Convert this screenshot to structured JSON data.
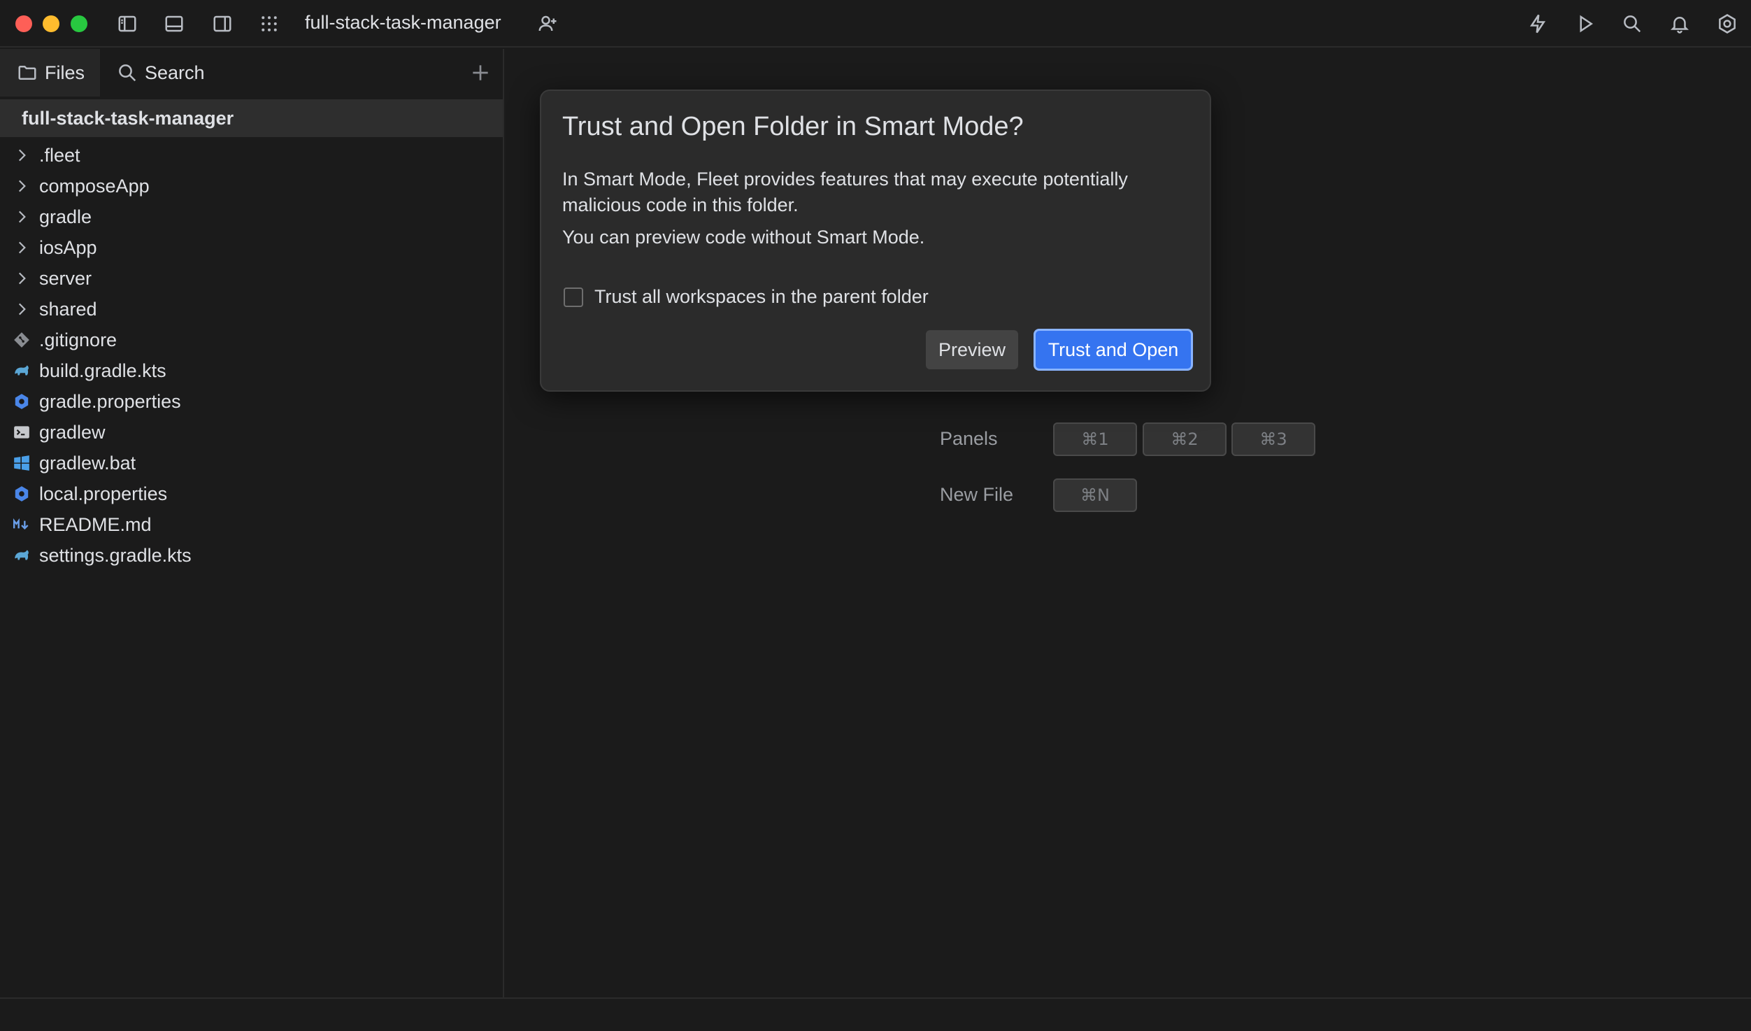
{
  "window": {
    "project_title": "full-stack-task-manager"
  },
  "sidebar": {
    "tabs": [
      {
        "label": "Files",
        "icon": "folder-icon"
      },
      {
        "label": "Search",
        "icon": "search-icon"
      }
    ],
    "root": "full-stack-task-manager",
    "items": [
      {
        "label": ".fleet",
        "type": "folder"
      },
      {
        "label": "composeApp",
        "type": "folder"
      },
      {
        "label": "gradle",
        "type": "folder"
      },
      {
        "label": "iosApp",
        "type": "folder"
      },
      {
        "label": "server",
        "type": "folder"
      },
      {
        "label": "shared",
        "type": "folder"
      },
      {
        "label": ".gitignore",
        "type": "git-file"
      },
      {
        "label": "build.gradle.kts",
        "type": "gradle-file"
      },
      {
        "label": "gradle.properties",
        "type": "properties-file"
      },
      {
        "label": "gradlew",
        "type": "terminal-file"
      },
      {
        "label": "gradlew.bat",
        "type": "windows-file"
      },
      {
        "label": "local.properties",
        "type": "properties-file"
      },
      {
        "label": "README.md",
        "type": "markdown-file"
      },
      {
        "label": "settings.gradle.kts",
        "type": "gradle-file"
      }
    ]
  },
  "shortcuts": {
    "panels_label": "Panels",
    "panels_keys": [
      "⌘1",
      "⌘2",
      "⌘3"
    ],
    "newfile_label": "New File",
    "newfile_key": "⌘N"
  },
  "dialog": {
    "title": "Trust and Open Folder in Smart Mode?",
    "text1": "In Smart Mode, Fleet provides features that may execute potentially malicious code in this folder.",
    "text2": "You can preview code without Smart Mode.",
    "checkbox_label": "Trust all workspaces in the parent folder",
    "checkbox_checked": false,
    "preview_label": "Preview",
    "trust_label": "Trust and Open"
  },
  "colors": {
    "accent": "#3574f0",
    "background": "#1b1b1b",
    "dialog_bg": "#2b2b2b"
  }
}
